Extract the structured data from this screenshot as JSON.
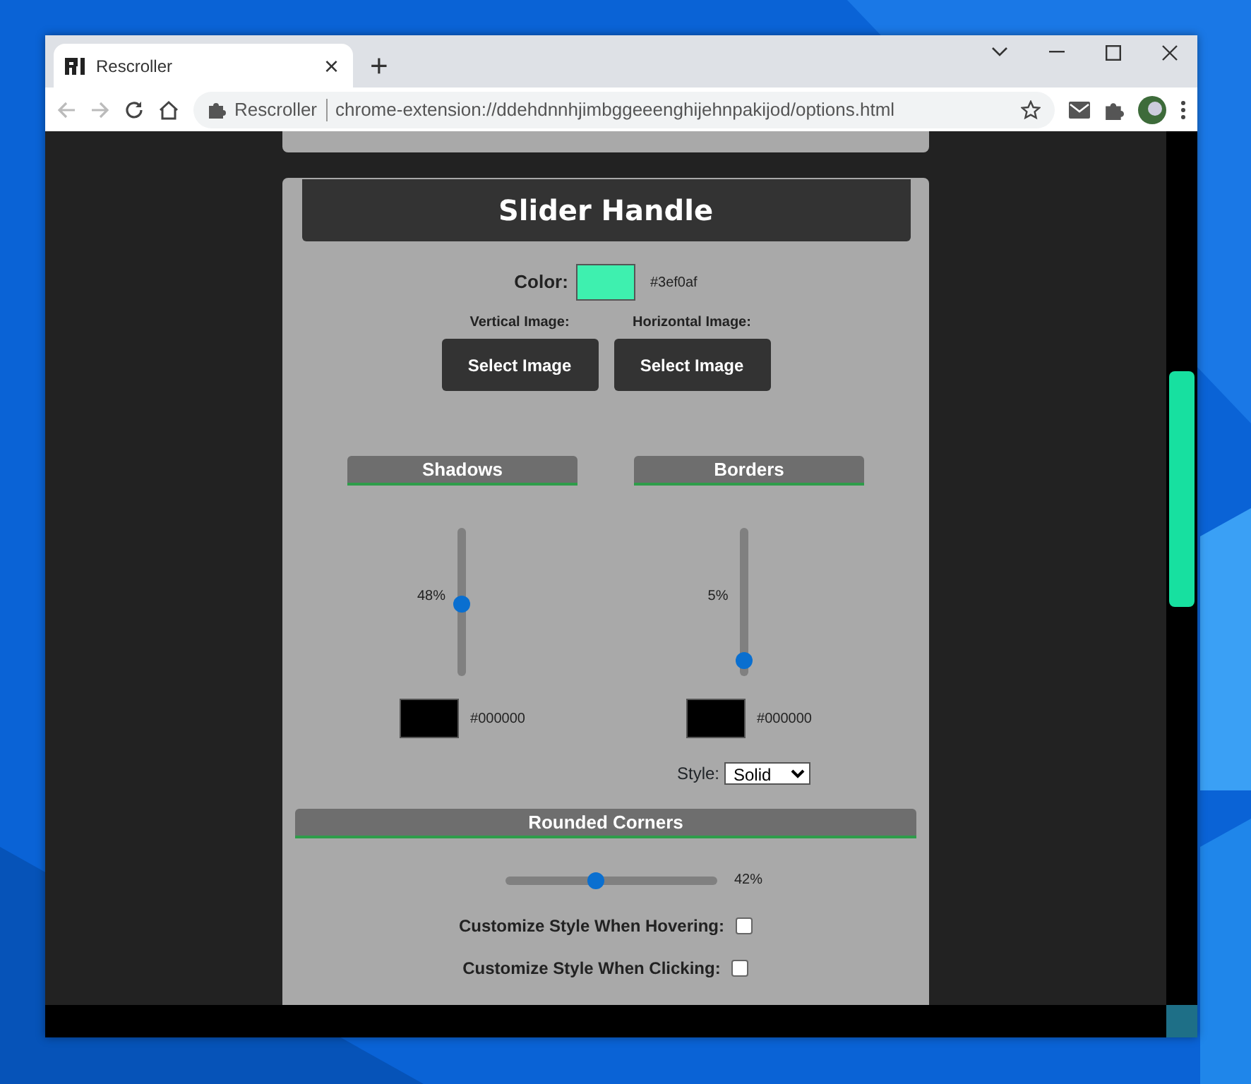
{
  "browser": {
    "tab": {
      "title": "Rescroller",
      "close": "×",
      "new_tab": "+"
    },
    "address": {
      "site": "Rescroller",
      "url": "chrome-extension://ddehdnnhjimbggeeenghijehnpakijod/options.html"
    }
  },
  "section": {
    "title": "Slider Handle",
    "color_label": "Color:",
    "color": "#3ef0af",
    "color_value": "#3ef0af"
  },
  "images": [
    {
      "label": "Vertical Image:",
      "button": "Select Image"
    },
    {
      "label": "Horizontal Image:",
      "button": "Select Image"
    }
  ],
  "panels": [
    {
      "title": "Shadows",
      "reading": "48%",
      "level": 0.48,
      "color": "#000000",
      "color_value": "#000000"
    },
    {
      "title": "Borders",
      "reading": "5%",
      "level": 0.05,
      "color": "#000000",
      "color_value": "#000000",
      "style_label": "Style:",
      "style": "Solid"
    }
  ],
  "rounded": {
    "title": "Rounded Corners",
    "level": 0.42,
    "reading": "42%"
  },
  "options": [
    {
      "label": "Customize Style When Hovering:",
      "checked": false
    },
    {
      "label": "Customize Style When Clicking:",
      "checked": false
    }
  ]
}
